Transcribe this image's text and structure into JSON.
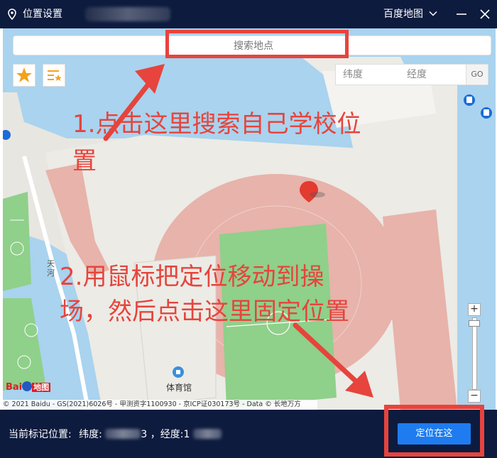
{
  "window": {
    "title": "位置设置",
    "provider": "百度地图",
    "icons": {
      "location": "location-pin-icon",
      "dropdown": "chevron-down-icon",
      "minimize": "minimize-icon",
      "close": "close-icon"
    }
  },
  "search": {
    "placeholder": "搜索地点"
  },
  "coord": {
    "lat_placeholder": "纬度",
    "lng_placeholder": "经度",
    "go_label": "GO"
  },
  "map_labels": {
    "gymnasium": "体育馆",
    "road": "天河"
  },
  "annotations": {
    "step1_line1": "1.点击这里搜索自己学校位",
    "step1_line2": "置",
    "step2_line1": "2.用鼠标把定位移动到操",
    "step2_line2": "场，然后点击这里固定位置"
  },
  "logo": {
    "text_baidu": "Bai",
    "text_ditu": "地图"
  },
  "copyright": "© 2021 Baidu - GS(2021)6026号 - 甲测资字1100930 - 京ICP证030173号 - Data © 长地万方",
  "footer": {
    "current_label": "当前标记位置:",
    "lat_label": "纬度:",
    "lat_visible_fragment": "3",
    "lng_label": "，经度:",
    "lng_visible_fragment": "1",
    "confirm_label": "定位在这"
  },
  "colors": {
    "titlebar": "#0d1b3e",
    "accent": "#1e7cf0",
    "annotation": "#e6443c",
    "water": "#a9d3ee",
    "track": "#e7b3ab",
    "field": "#8fd08a"
  }
}
